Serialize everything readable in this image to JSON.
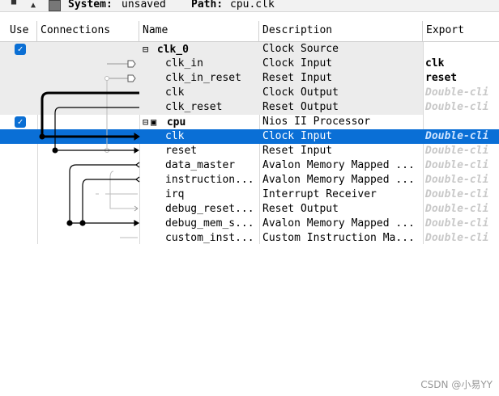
{
  "toolbar": {
    "system_label": "System:",
    "system_value": "unsaved",
    "path_label": "Path:",
    "path_value": "cpu.clk"
  },
  "columns": {
    "use": "Use",
    "connections": "Connections",
    "name": "Name",
    "description": "Description",
    "export": "Export"
  },
  "rows": [
    {
      "name": "clk_0",
      "desc": "Clock Source",
      "export": "",
      "type": "module",
      "use": true
    },
    {
      "name": "clk_in",
      "desc": "Clock Input",
      "export": "clk",
      "type": "port"
    },
    {
      "name": "clk_in_reset",
      "desc": "Reset Input",
      "export": "reset",
      "type": "port"
    },
    {
      "name": "clk",
      "desc": "Clock Output",
      "export": "Double-cli",
      "type": "port"
    },
    {
      "name": "clk_reset",
      "desc": "Reset Output",
      "export": "Double-cli",
      "type": "port"
    },
    {
      "name": "cpu",
      "desc": "Nios II Processor",
      "export": "",
      "type": "module",
      "use": true
    },
    {
      "name": "clk",
      "desc": "Clock Input",
      "export": "Double-cli",
      "type": "port",
      "selected": true
    },
    {
      "name": "reset",
      "desc": "Reset Input",
      "export": "Double-cli",
      "type": "port"
    },
    {
      "name": "data_master",
      "desc": "Avalon Memory Mapped ...",
      "export": "Double-cli",
      "type": "port"
    },
    {
      "name": "instruction...",
      "desc": "Avalon Memory Mapped ...",
      "export": "Double-cli",
      "type": "port"
    },
    {
      "name": "irq",
      "desc": "Interrupt Receiver",
      "export": "Double-cli",
      "type": "port"
    },
    {
      "name": "debug_reset...",
      "desc": "Reset Output",
      "export": "Double-cli",
      "type": "port"
    },
    {
      "name": "debug_mem_s...",
      "desc": "Avalon Memory Mapped ...",
      "export": "Double-cli",
      "type": "port"
    },
    {
      "name": "custom_inst...",
      "desc": "Custom Instruction Ma...",
      "export": "Double-cli",
      "type": "port"
    }
  ],
  "watermark": "CSDN @小易YY",
  "colors": {
    "selection": "#0a6fd6",
    "checkbox": "#0b6fd4",
    "grey_row": "#ececec"
  }
}
